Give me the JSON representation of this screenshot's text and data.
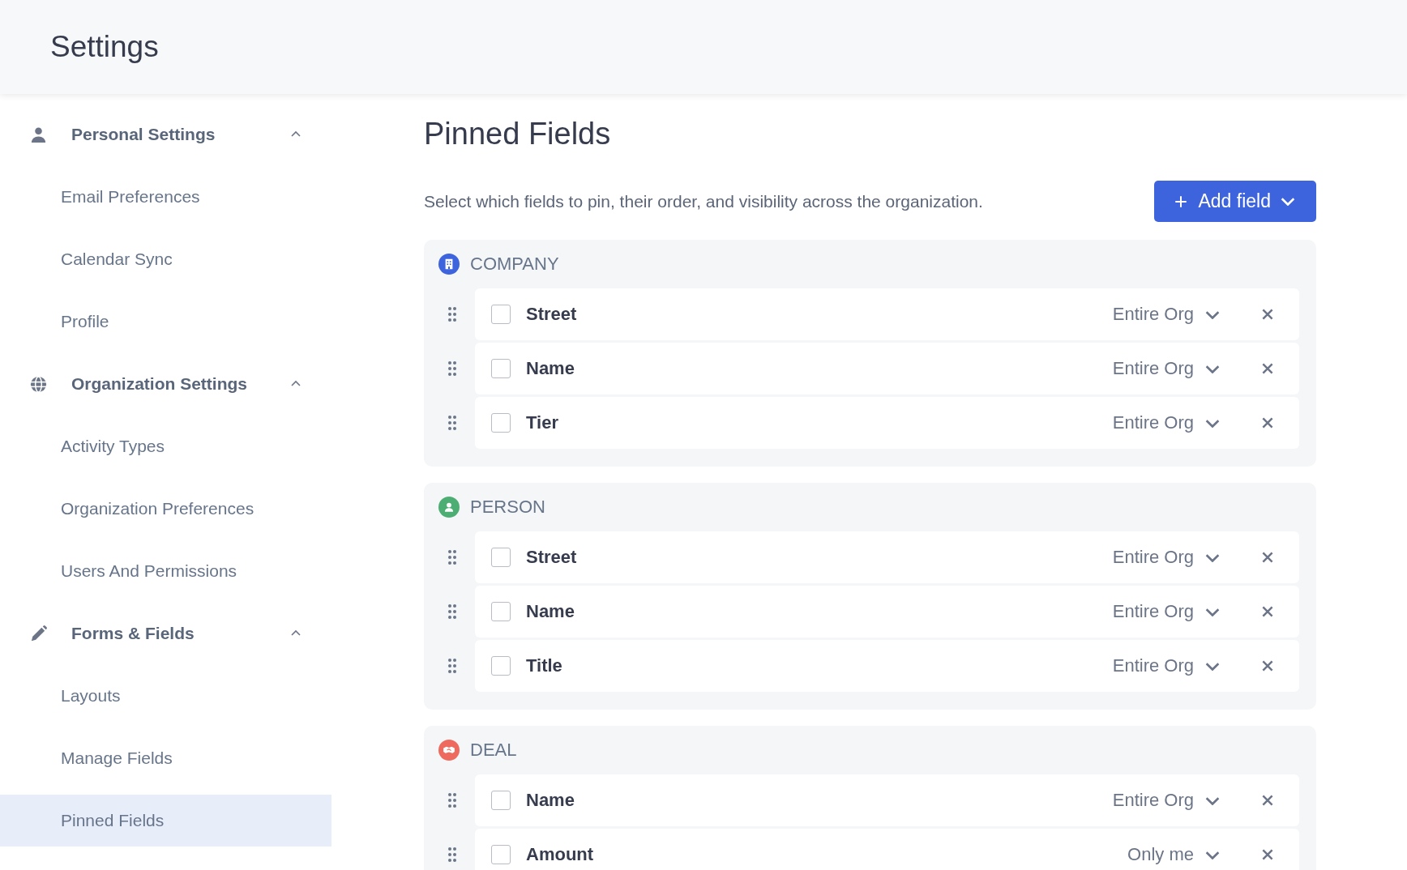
{
  "header": {
    "title": "Settings"
  },
  "sidebar": {
    "groups": [
      {
        "kind": "person",
        "label": "Personal Settings",
        "expanded": true,
        "items": [
          {
            "label": "Email Preferences",
            "selected": false
          },
          {
            "label": "Calendar Sync",
            "selected": false
          },
          {
            "label": "Profile",
            "selected": false
          }
        ]
      },
      {
        "kind": "globe",
        "label": "Organization Settings",
        "expanded": true,
        "items": [
          {
            "label": "Activity Types",
            "selected": false
          },
          {
            "label": "Organization Preferences",
            "selected": false
          },
          {
            "label": "Users And Permissions",
            "selected": false
          }
        ]
      },
      {
        "kind": "pencil",
        "label": "Forms & Fields",
        "expanded": true,
        "items": [
          {
            "label": "Layouts",
            "selected": false
          },
          {
            "label": "Manage Fields",
            "selected": false
          },
          {
            "label": "Pinned Fields",
            "selected": true
          }
        ]
      }
    ]
  },
  "main": {
    "title": "Pinned Fields",
    "description": "Select which fields to pin, their order, and visibility across the organization.",
    "add_button": "Add field",
    "sections": [
      {
        "kind": "company",
        "title": "COMPANY",
        "color": "#3d63dd",
        "fields": [
          {
            "label": "Street",
            "checked": false,
            "visibility": "Entire Org"
          },
          {
            "label": "Name",
            "checked": false,
            "visibility": "Entire Org"
          },
          {
            "label": "Tier",
            "checked": false,
            "visibility": "Entire Org"
          }
        ]
      },
      {
        "kind": "person",
        "title": "PERSON",
        "color": "#4cae72",
        "fields": [
          {
            "label": "Street",
            "checked": false,
            "visibility": "Entire Org"
          },
          {
            "label": "Name",
            "checked": false,
            "visibility": "Entire Org"
          },
          {
            "label": "Title",
            "checked": false,
            "visibility": "Entire Org"
          }
        ]
      },
      {
        "kind": "deal",
        "title": "DEAL",
        "color": "#ee6a5f",
        "fields": [
          {
            "label": "Name",
            "checked": false,
            "visibility": "Entire Org"
          },
          {
            "label": "Amount",
            "checked": false,
            "visibility": "Only me"
          }
        ]
      }
    ]
  }
}
